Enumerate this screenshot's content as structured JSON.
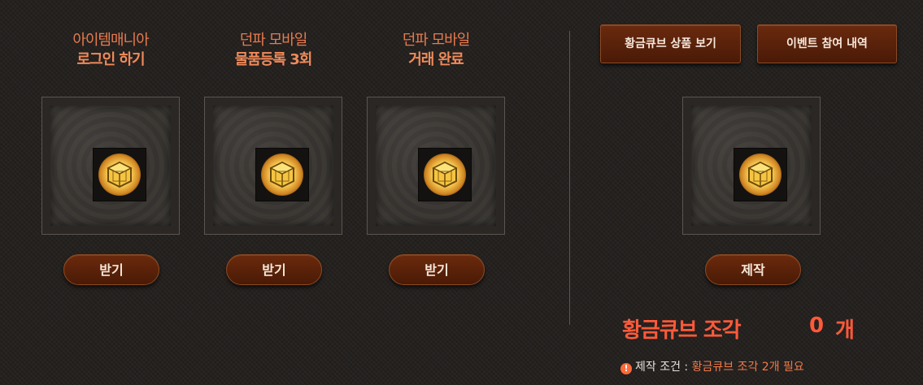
{
  "missions": [
    {
      "line1": "아이템매니아",
      "line2": "로그인 하기",
      "button": "받기",
      "item_icon": "golden-cube-icon"
    },
    {
      "line1": "던파 모바일",
      "line2": "물품등록 3회",
      "button": "받기",
      "item_icon": "golden-cube-icon"
    },
    {
      "line1": "던파 모바일",
      "line2": "거래 완료",
      "button": "받기",
      "item_icon": "golden-cube-icon"
    }
  ],
  "top_buttons": {
    "view_products": "황금큐브 상품 보기",
    "history": "이벤트 참여 내역"
  },
  "craft": {
    "item_icon": "golden-cube-icon",
    "button": "제작",
    "count_label": "황금큐브 조각",
    "count_value": "0",
    "count_unit": "개",
    "condition_label": "제작 조건",
    "condition_sep": " : ",
    "condition_value": "황금큐브 조각 2개 필요"
  },
  "colors": {
    "background": "#221f1d",
    "accent_orange": "#f08a5a",
    "count_red": "#ff5a3a",
    "button_brown": "#5a2209"
  }
}
